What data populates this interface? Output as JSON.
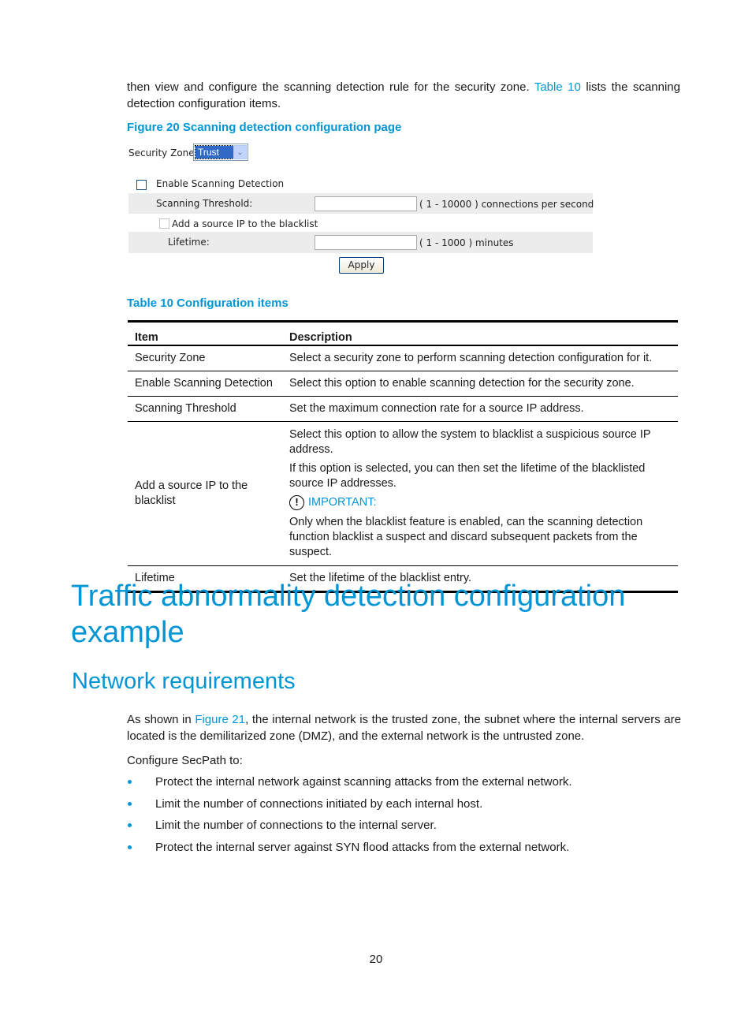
{
  "intro": {
    "text_before_link": "then view and configure the scanning detection rule for the security zone. ",
    "link": "Table 10",
    "text_after_link": " lists the scanning detection configuration items."
  },
  "figure": {
    "caption": "Figure 20 Scanning detection configuration page",
    "security_zone_label": "Security Zone:",
    "security_zone_value": "Trust",
    "dropdown_icon": "chevron-down-icon",
    "enable_label": "Enable Scanning Detection",
    "enable_checked": false,
    "threshold_label": "Scanning Threshold:",
    "threshold_value": "",
    "threshold_range": "( 1 - 10000 ) connections per second",
    "blacklist_label": "Add a source IP to the blacklist",
    "blacklist_checked": false,
    "lifetime_label": "Lifetime:",
    "lifetime_value": "",
    "lifetime_range": "( 1 - 1000 ) minutes",
    "apply_label": "Apply"
  },
  "table": {
    "caption": "Table 10 Configuration items",
    "headers": [
      "Item",
      "Description"
    ],
    "rows": [
      {
        "item": "Security Zone",
        "description": "Select a security zone to perform scanning detection configuration for it."
      },
      {
        "item": "Enable Scanning Detection",
        "description": "Select this option to enable scanning detection for the security zone."
      },
      {
        "item": "Scanning Threshold",
        "description": "Set the maximum connection rate for a source IP address."
      },
      {
        "item": "Add a source IP to the blacklist",
        "description_parts": [
          "Select this option to allow the system to blacklist a suspicious source IP address.",
          "If this option is selected, you can then set the lifetime of the blacklisted source IP addresses."
        ],
        "important_icon": "!",
        "important_label": "IMPORTANT:",
        "important_text": "Only when the blacklist feature is enabled, can the scanning detection function blacklist a suspect and discard subsequent packets from the suspect."
      },
      {
        "item": "Lifetime",
        "description": "Set the lifetime of the blacklist entry."
      }
    ]
  },
  "section": {
    "heading": "Traffic abnormality detection configuration example",
    "subheading": "Network requirements",
    "para_before_link": "As shown in ",
    "para_link": "Figure 21",
    "para_after_link": ", the internal network is the trusted zone, the subnet where the internal servers are located is the demilitarized zone (DMZ), and the external network is the untrusted zone.",
    "configure_label": "Configure SecPath to:",
    "bullets": [
      "Protect the internal network against scanning attacks from the external network.",
      "Limit the number of connections initiated by each internal host.",
      "Limit the number of connections to the internal server.",
      "Protect the internal server against SYN flood attacks from the external network."
    ]
  },
  "page_number": "20",
  "colors": {
    "accent": "#0096d6",
    "form_band": "#ececec",
    "selection": "#3169c6"
  }
}
